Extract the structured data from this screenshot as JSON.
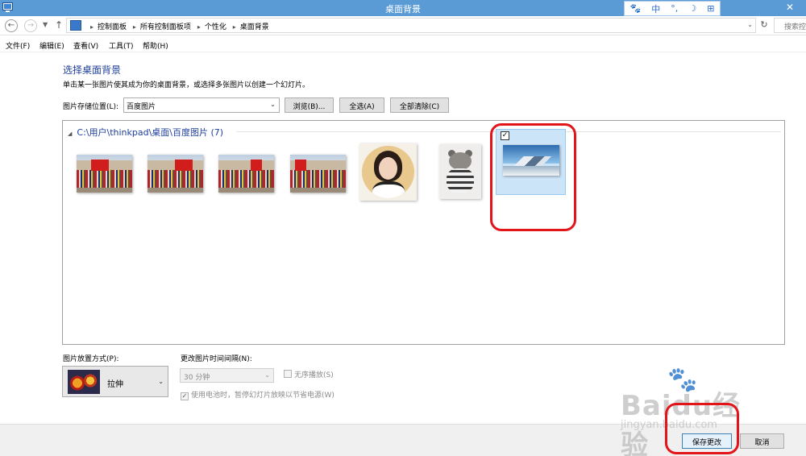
{
  "window": {
    "title": "桌面背景",
    "app_icon": "control-panel-icon",
    "title_bar_color": "#5b9bd5"
  },
  "ime_bar": {
    "items": [
      "中",
      "°,",
      "☽",
      "⊞"
    ]
  },
  "address": {
    "crumbs": [
      "控制面板",
      "所有控制面板项",
      "个性化",
      "桌面背景"
    ],
    "search_placeholder": "搜索控"
  },
  "menu": [
    "文件(F)",
    "编辑(E)",
    "查看(V)",
    "工具(T)",
    "帮助(H)"
  ],
  "main": {
    "title": "选择桌面背景",
    "description": "单击某一张图片使其成为你的桌面背景，或选择多张图片以创建一个幻灯片。",
    "location_label": "图片存储位置(L):",
    "location_value": "百度图片",
    "browse_button": "浏览(B)...",
    "select_all_button": "全选(A)",
    "clear_all_button": "全部清除(C)",
    "group_header": "C:\\用户\\thinkpad\\桌面\\百度图片 (7)",
    "pictures": [
      {
        "name": "group-photo-1",
        "selected": false
      },
      {
        "name": "group-photo-2",
        "selected": false
      },
      {
        "name": "group-photo-3",
        "selected": false
      },
      {
        "name": "group-photo-4",
        "selected": false
      },
      {
        "name": "portrait-photo",
        "selected": false
      },
      {
        "name": "bear-photo",
        "selected": false
      },
      {
        "name": "landscape-photo",
        "selected": true
      }
    ],
    "position_label": "图片放置方式(P):",
    "position_value": "拉伸",
    "interval_label": "更改图片时间间隔(N):",
    "interval_value": "30 分钟",
    "shuffle_label": "无序播放(S)",
    "shuffle_checked": false,
    "battery_label": "使用电池时，暂停幻灯片放映以节省电源(W)",
    "battery_checked": true
  },
  "footer": {
    "save_button": "保存更改",
    "cancel_button": "取消"
  },
  "accent_colors": {
    "highlight": "#e4141b",
    "selection": "#cce4f7",
    "link_blue": "#1f3f9a"
  },
  "watermark": {
    "main": "Baidu经验",
    "sub": "jingyan.baidu.com"
  }
}
